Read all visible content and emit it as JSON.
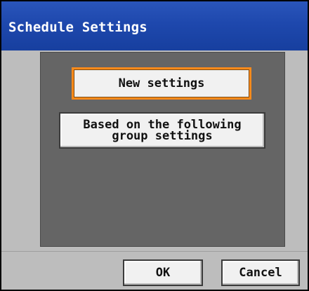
{
  "window": {
    "title": "Schedule Settings"
  },
  "dialog": {
    "new_settings_label": "New settings",
    "based_on_group_label": "Based on the following\ngroup settings"
  },
  "footer": {
    "ok_label": "OK",
    "cancel_label": "Cancel"
  },
  "colors": {
    "title_bar": "#1e48ad",
    "selected_border": "#ff8a1a",
    "panel": "#656565",
    "background": "#bdbdbd"
  }
}
